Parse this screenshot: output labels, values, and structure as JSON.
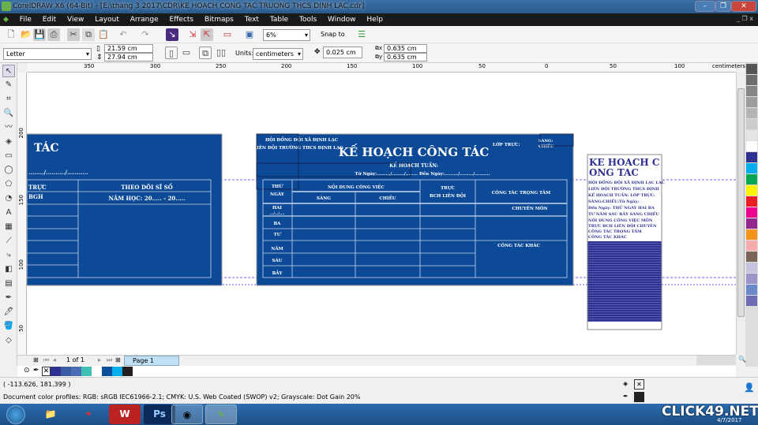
{
  "window": {
    "title": "CorelDRAW X6 (64-Bit) - [E:\\thang 3 2017\\CDR\\KE HOACH CONG TAC TRUONG THCS DINH LAC.cdr]",
    "minimize": "–",
    "restore": "❐",
    "close": "✕"
  },
  "menu": [
    "File",
    "Edit",
    "View",
    "Layout",
    "Arrange",
    "Effects",
    "Bitmaps",
    "Text",
    "Table",
    "Tools",
    "Window",
    "Help"
  ],
  "toolbar": {
    "zoom": "6%",
    "snap_to": "Snap to"
  },
  "propbar": {
    "page_size": "Letter",
    "width": "21.59 cm",
    "height": "27.94 cm",
    "units_label": "Units:",
    "units": "centimeters",
    "nudge": "0.025 cm",
    "dup_x": "0.635 cm",
    "dup_y": "0.635 cm"
  },
  "ruler": {
    "h_ticks": [
      "350",
      "300",
      "250",
      "200",
      "150",
      "100",
      "50",
      "0",
      "50",
      "100"
    ],
    "unit": "centimeters",
    "v_ticks": [
      "200",
      "150",
      "100",
      "50"
    ]
  },
  "doc_left": {
    "title": "TÁC",
    "date_line": "......../........../...........",
    "col1_h1": "TRỰC",
    "col1_h2": "BGH",
    "col2_h1": "THEO DÕI SĨ SỐ",
    "col2_h2": "NĂM HỌC: 20..... - 20....."
  },
  "doc_center": {
    "org1": "HỘI ĐỒNG ĐỘI XÃ ĐỊNH LẠC",
    "org2": "LIÊN ĐỘI TRƯỜNG THCS ĐỊNH LẠC",
    "title": "KẾ HOẠCH CÔNG TÁC",
    "class_label": "LỚP TRỰC:",
    "sang": "SÁNG:",
    "chieu": "CHIỀU",
    "week": "KẾ HOẠCH TUẦN:",
    "dates": "Từ Ngày:........./......../........ Đến Ngày:........./........./..........",
    "h_thu": "THỨ",
    "h_ngay": "NGÀY",
    "h_noidung": "NỘI DUNG CÔNG VIỆC",
    "h_sang": "SÁNG",
    "h_chieu": "CHIỀU",
    "h_truc": "TRỰC",
    "h_bch": "BCH LIÊN ĐỘI",
    "h_trongtam": "CÔNG TÁC TRỌNG TÂM",
    "days": [
      "HAI",
      "BA",
      "TƯ",
      "NĂM",
      "SÁU",
      "BẢY"
    ],
    "hai_date": ".../.../....",
    "chuyenmon": "CHUYÊN MÔN",
    "khac": "CÔNG TÁC KHÁC"
  },
  "doc_right": {
    "title1": "KE HOACH C",
    "title2": "ONG TAC",
    "lines": [
      "HỘI ĐỒNG ĐỘI XÃ ĐỊNH LẠC LẠC",
      "LIÊN ĐỘI TRƯỜNG THCS ĐỊNH",
      "KẾ HOẠCH TUẦN: LỚP TRỰC:",
      "SÁNG:CHIỀU:Từ Ngày:",
      "Đến Ngày: THỨ NGÀY HAI BA",
      "TƯ NĂM SÁU BẢY SÁNG CHIỀU",
      "NỘI DUNG CÔNG VIỆC MÔN",
      "TRỰC BCH LIÊN ĐỘI CHUYÊN",
      "CÔNG TÁC TRỌNG TÂM",
      "CÔNG TÁC KHÁC"
    ]
  },
  "pagenav": {
    "count": "1 of 1",
    "tab": "Page 1"
  },
  "doc_palette": [
    "#2e3192",
    "#3b5ba5",
    "#4a6db5",
    "#40c0b5",
    "#ffffff",
    "#0a4d9c",
    "#00aeef",
    "#231f20"
  ],
  "palette": [
    "#555555",
    "#6d6d6d",
    "#858585",
    "#9d9d9d",
    "#b5b5b5",
    "#cccccc",
    "#e4e4e4",
    "#ffffff",
    "#2e3192",
    "#00aeef",
    "#00a651",
    "#fff200",
    "#ed1c24",
    "#ec008c",
    "#92278f",
    "#f7941d",
    "#f9aaaa",
    "#7a6558",
    "#c5c3e0",
    "#9d94c9",
    "#6a89c8",
    "#6e6cb5"
  ],
  "status": {
    "coords": "( -113.626, 181.399 )",
    "profiles": "Document color profiles: RGB: sRGB IEC61966-2.1; CMYK: U.S. Web Coated (SWOP) v2; Grayscale: Dot Gain 20%"
  },
  "taskbar": {
    "watermark": "CLICK49.NET",
    "date": "4/7/2017"
  },
  "colors": {
    "doc_blue": "#0c4a98",
    "accent_lines": "#c9d6ee"
  }
}
